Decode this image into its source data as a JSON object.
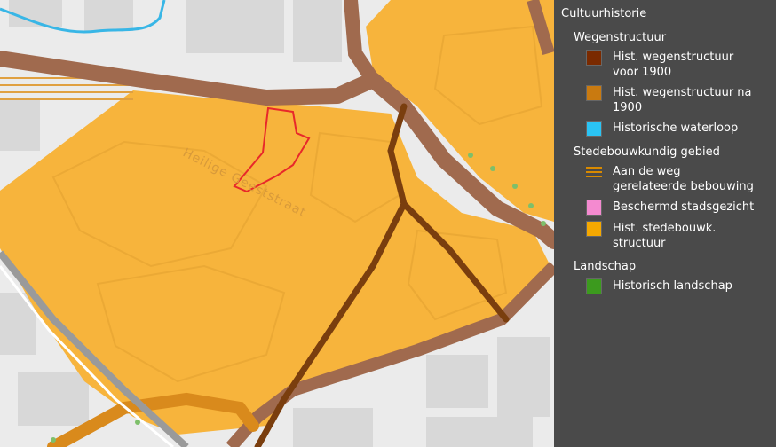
{
  "map": {
    "street_label": "Heilige Geeststraat",
    "colors": {
      "background": "#ebebeb",
      "building": "#d8d8d8",
      "orange_area": "#f7b43c",
      "brown_road": "#8b5a3c",
      "dark_road": "#7a3e0e",
      "water": "#38b6e6",
      "parcel_outline": "#e8282a",
      "green_dot": "#7ebf6a"
    }
  },
  "legend": {
    "title": "Cultuurhistorie",
    "groups": [
      {
        "name": "Wegenstructuur",
        "items": [
          {
            "label": "Hist. wegenstructuur voor 1900",
            "swatch": "#7a2a00",
            "type": "solid"
          },
          {
            "label": "Hist. wegenstructuur na 1900",
            "swatch": "#c97a10",
            "type": "solid"
          },
          {
            "label": "Historische waterloop",
            "swatch": "#2ac4f4",
            "type": "solid"
          }
        ]
      },
      {
        "name": "Stedebouwkundig gebied",
        "items": [
          {
            "label": "Aan de weg gerelateerde bebouwing",
            "swatch": "#d98a00",
            "type": "hatch"
          },
          {
            "label": "Beschermd stadsgezicht",
            "swatch": "#f48ad0",
            "type": "solid"
          },
          {
            "label": "Hist. stedebouwk. structuur",
            "swatch": "#f5a800",
            "type": "solid"
          }
        ]
      },
      {
        "name": "Landschap",
        "items": [
          {
            "label": "Historisch landschap",
            "swatch": "#3c9a1e",
            "type": "solid"
          }
        ]
      }
    ]
  }
}
